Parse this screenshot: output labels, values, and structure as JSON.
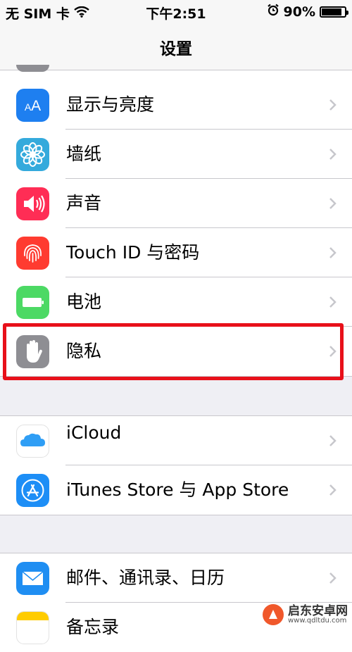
{
  "status_bar": {
    "carrier": "无 SIM 卡",
    "time": "下午2:51",
    "battery_percent": "90%",
    "battery_level": 0.9,
    "icons": [
      "wifi-icon",
      "alarm-icon",
      "battery-icon"
    ]
  },
  "nav": {
    "title": "设置"
  },
  "groups": [
    {
      "items": [
        {
          "label": "显示与亮度",
          "icon": "display-brightness-icon",
          "color": "#1e7ff0"
        },
        {
          "label": "墙纸",
          "icon": "wallpaper-icon",
          "color": "#34aadc"
        },
        {
          "label": "声音",
          "icon": "sound-icon",
          "color": "#ff2d55"
        },
        {
          "label": "Touch ID 与密码",
          "icon": "fingerprint-icon",
          "color": "#ff3b30"
        },
        {
          "label": "电池",
          "icon": "battery-setting-icon",
          "color": "#4cd964"
        },
        {
          "label": "隐私",
          "icon": "privacy-hand-icon",
          "color": "#8e8e93",
          "highlighted": true
        }
      ]
    },
    {
      "items": [
        {
          "label": "iCloud",
          "icon": "icloud-icon",
          "color": "#2f9ef5"
        },
        {
          "label": "iTunes Store 与 App Store",
          "icon": "app-store-icon",
          "color": "#1d8ef6"
        }
      ]
    },
    {
      "items": [
        {
          "label": "邮件、通讯录、日历",
          "icon": "mail-icon",
          "color": "#1f8ef2"
        },
        {
          "label": "备忘录",
          "icon": "notes-icon",
          "color": "#ffcc00"
        }
      ]
    }
  ],
  "watermark": {
    "main": "启东安卓网",
    "sub": "www.qdltdu.com"
  }
}
